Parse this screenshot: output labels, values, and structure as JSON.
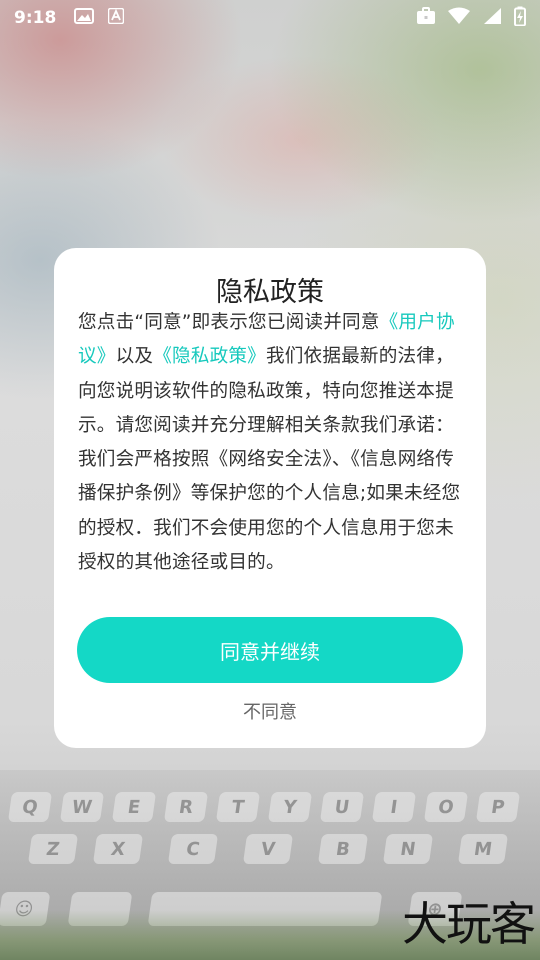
{
  "status_bar": {
    "time": "9:18",
    "icons_left": [
      "image-icon",
      "font-icon"
    ],
    "icons_right": [
      "briefcase-icon",
      "wifi-icon",
      "signal-icon",
      "battery-charging-icon"
    ]
  },
  "dialog": {
    "title": "隐私政策",
    "body_part1": "您点击“同意”即表示您已阅读并同意",
    "link_user_agreement": "《用户协议》",
    "body_part2": "以及",
    "link_privacy_policy": "《隐私政策》",
    "body_part3": "我们依据最新的法律，向您说明该软件的隐私政策，特向您推送本提示。请您阅读并充分理解相关条款我们承诺：我们会严格按照《网络安全法》、《信息网络传播保护条例》等保护您的个人信息;如果未经您的授权．我们不会使用您的个人信息用于您未授权的其他途径或目的。",
    "agree_label": "同意并继续",
    "disagree_label": "不同意"
  },
  "keyboard_background": {
    "row1": [
      "Q",
      "W",
      "E",
      "R",
      "T",
      "Y",
      "U",
      "I",
      "O",
      "P"
    ],
    "row2": [
      "Z",
      "X",
      "C",
      "V",
      "B",
      "N",
      "M"
    ]
  },
  "watermark": "大玩客",
  "colors": {
    "accent": "#14d8c6",
    "link": "#17c9bd",
    "dialog_bg": "#ffffff"
  }
}
